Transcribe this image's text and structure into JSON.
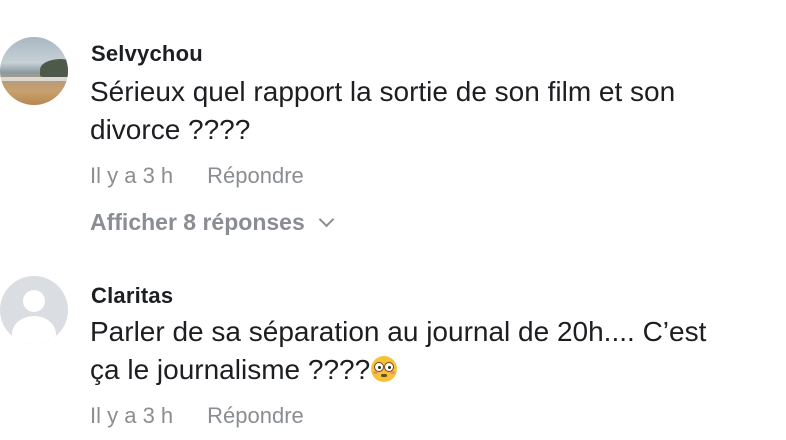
{
  "comments": [
    {
      "author": "Selvychou",
      "avatar": "beach-photo-avatar",
      "text_line1": "Sérieux quel rapport la sortie de son film et son",
      "text_line2": "divorce ????",
      "time": "Il y a 3 h",
      "reply_label": "Répondre",
      "view_replies_label": "Afficher 8 réponses"
    },
    {
      "author": "Claritas",
      "avatar": "default-profile-avatar",
      "text_line1": "Parler de sa séparation au journal de 20h.... C’est",
      "text_line2": "ça le journalisme ????",
      "emoji": "flushed-face-emoji",
      "time": "Il y a 3 h",
      "reply_label": "Répondre"
    }
  ],
  "colors": {
    "text": "#1c1e21",
    "secondary": "#8a8d91",
    "background": "#ffffff"
  }
}
